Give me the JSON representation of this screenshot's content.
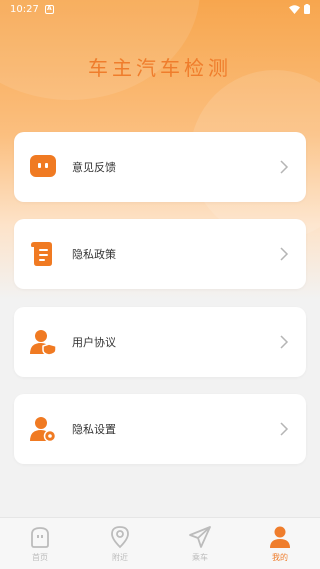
{
  "status_bar": {
    "time": "10:27",
    "notification_icon": "a-square-icon"
  },
  "title": "车主汽车检测",
  "menu": [
    {
      "label": "意见反馈",
      "icon": "feedback-icon"
    },
    {
      "label": "隐私政策",
      "icon": "document-scroll-icon"
    },
    {
      "label": "用户协议",
      "icon": "user-shield-icon"
    },
    {
      "label": "隐私设置",
      "icon": "user-settings-icon"
    }
  ],
  "bottom_nav": [
    {
      "label": "首页",
      "icon": "home-icon",
      "active": false
    },
    {
      "label": "附近",
      "icon": "location-pin-icon",
      "active": false
    },
    {
      "label": "乘车",
      "icon": "paper-plane-icon",
      "active": false
    },
    {
      "label": "我的",
      "icon": "profile-icon",
      "active": true
    }
  ],
  "colors": {
    "accent": "#ef7d2c",
    "inactive": "#bcbcbc",
    "background": "#f2f2f2"
  }
}
